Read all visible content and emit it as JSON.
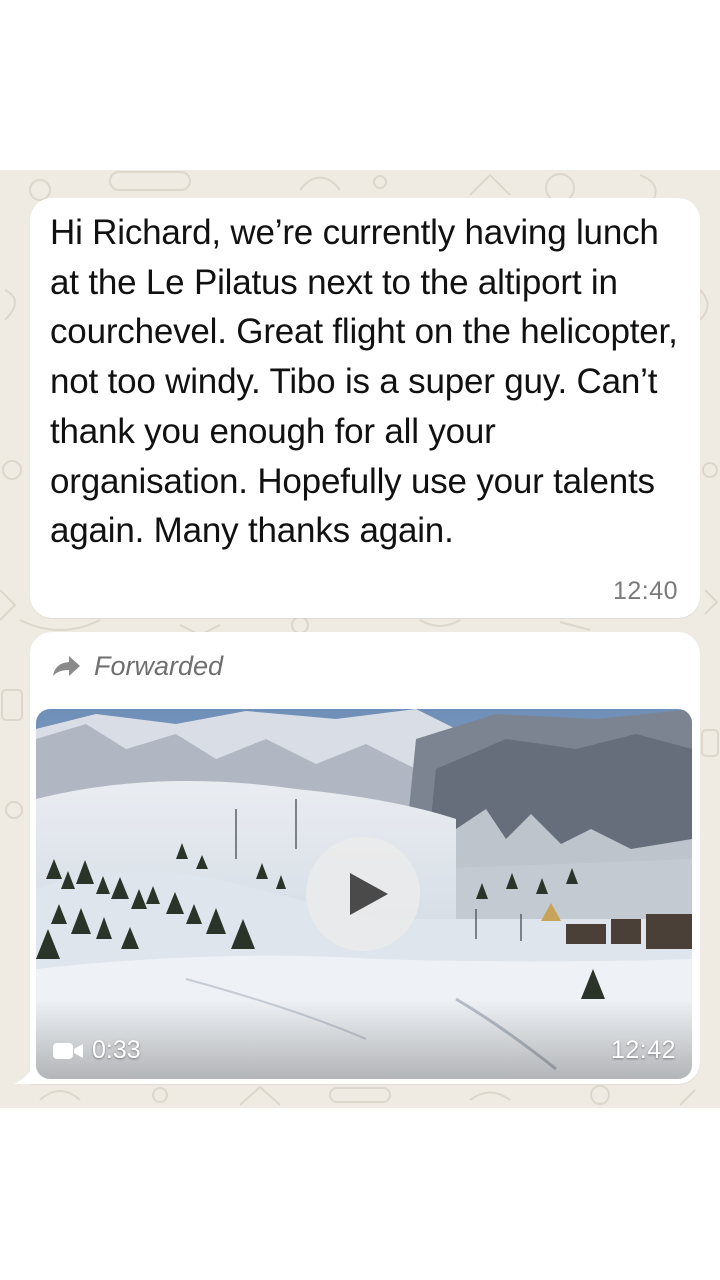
{
  "colors": {
    "chat_background": "#efeae2",
    "bubble": "#ffffff",
    "meta_text": "#7a7a7a"
  },
  "messages": [
    {
      "text": "Hi Richard, we’re currently having lunch at the Le Pilatus next to the altiport in courchevel. Great flight on the helicopter, not too windy. Tibo is a super guy. Can’t thank you enough for all your organisation. Hopefully use your talents again.  Many thanks again.",
      "time": "12:40"
    },
    {
      "forwarded_label": "Forwarded",
      "forwarded_icon": "forward-arrow-icon",
      "video": {
        "duration": "0:33",
        "duration_icon": "video-camera-icon",
        "play_icon": "play-icon"
      },
      "time": "12:42"
    }
  ]
}
